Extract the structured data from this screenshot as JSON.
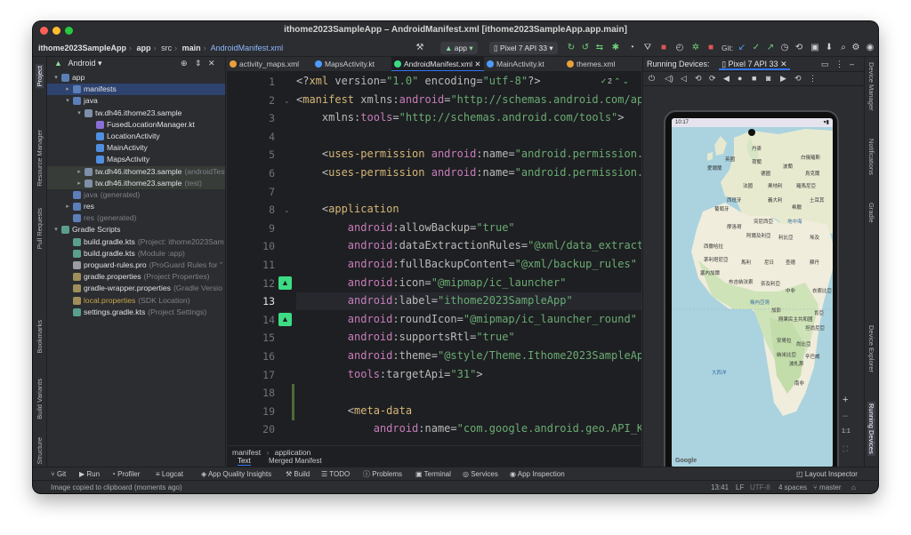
{
  "window": {
    "title": "ithome2023SampleApp – AndroidManifest.xml [ithome2023SampleApp.app.main]"
  },
  "toolbar": {
    "breadcrumb": [
      "ithome2023SampleApp",
      "app",
      "src",
      "main",
      "AndroidManifest.xml"
    ],
    "run_config": "app",
    "device": "Pixel 7 API 33",
    "git_label": "Git:"
  },
  "left_strip": [
    "Project",
    "Resource Manager",
    "Pull Requests",
    "Bookmarks",
    "Build Variants",
    "Structure"
  ],
  "right_strip": [
    "Device Manager",
    "Notifications",
    "Gradle",
    "Device Explorer",
    "Running Devices"
  ],
  "project": {
    "view": "Android",
    "tree": [
      {
        "label": "app",
        "extra": "",
        "depth": 0,
        "arrow": "▾",
        "icon": "folder-icon",
        "state": "normal"
      },
      {
        "label": "manifests",
        "extra": "",
        "depth": 1,
        "arrow": "▸",
        "icon": "folder-icon",
        "state": "selected"
      },
      {
        "label": "java",
        "extra": "",
        "depth": 1,
        "arrow": "▾",
        "icon": "folder-icon",
        "state": "normal"
      },
      {
        "label": "tw.dh46.ithome23.sample",
        "extra": "",
        "depth": 2,
        "arrow": "▾",
        "icon": "package-icon",
        "state": "normal"
      },
      {
        "label": "FusedLocationManager.kt",
        "extra": "",
        "depth": 3,
        "arrow": "",
        "icon": "kotlin-file-icon",
        "state": "normal"
      },
      {
        "label": "LocationActivity",
        "extra": "",
        "depth": 3,
        "arrow": "",
        "icon": "kotlin-class-icon",
        "state": "normal"
      },
      {
        "label": "MainActivity",
        "extra": "",
        "depth": 3,
        "arrow": "",
        "icon": "kotlin-class-icon",
        "state": "normal"
      },
      {
        "label": "MapsActivity",
        "extra": "",
        "depth": 3,
        "arrow": "",
        "icon": "kotlin-class-icon",
        "state": "normal"
      },
      {
        "label": "tw.dh46.ithome23.sample",
        "extra": "(androidTest)",
        "depth": 2,
        "arrow": "▸",
        "icon": "package-icon",
        "state": "group"
      },
      {
        "label": "tw.dh46.ithome23.sample",
        "extra": "(test)",
        "depth": 2,
        "arrow": "▸",
        "icon": "package-icon",
        "state": "group"
      },
      {
        "label": "java",
        "extra": "(generated)",
        "depth": 1,
        "arrow": "",
        "icon": "folder-icon",
        "state": "normal"
      },
      {
        "label": "res",
        "extra": "",
        "depth": 1,
        "arrow": "▸",
        "icon": "folder-icon",
        "state": "normal"
      },
      {
        "label": "res",
        "extra": "(generated)",
        "depth": 1,
        "arrow": "",
        "icon": "folder-icon",
        "state": "normal"
      },
      {
        "label": "Gradle Scripts",
        "extra": "",
        "depth": 0,
        "arrow": "▾",
        "icon": "gradle-icon",
        "state": "normal"
      },
      {
        "label": "build.gradle.kts",
        "extra": "(Project: ithome2023Sam",
        "depth": 1,
        "arrow": "",
        "icon": "gradle-file-icon",
        "state": "normal"
      },
      {
        "label": "build.gradle.kts",
        "extra": "(Module :app)",
        "depth": 1,
        "arrow": "",
        "icon": "gradle-file-icon",
        "state": "normal"
      },
      {
        "label": "proguard-rules.pro",
        "extra": "(ProGuard Rules for \"",
        "depth": 1,
        "arrow": "",
        "icon": "file-icon",
        "state": "normal"
      },
      {
        "label": "gradle.properties",
        "extra": "(Project Properties)",
        "depth": 1,
        "arrow": "",
        "icon": "properties-icon",
        "state": "normal"
      },
      {
        "label": "gradle-wrapper.properties",
        "extra": "(Gradle Versio",
        "depth": 1,
        "arrow": "",
        "icon": "properties-icon",
        "state": "normal"
      },
      {
        "label": "local.properties",
        "extra": "(SDK Location)",
        "depth": 1,
        "arrow": "",
        "icon": "properties-icon",
        "state": "muted"
      },
      {
        "label": "settings.gradle.kts",
        "extra": "(Project Settings)",
        "depth": 1,
        "arrow": "",
        "icon": "gradle-file-icon",
        "state": "normal"
      }
    ]
  },
  "editor": {
    "tabs": [
      {
        "label": "activity_maps.xml",
        "active": false
      },
      {
        "label": "MapsActivity.kt",
        "active": false
      },
      {
        "label": "AndroidManifest.xml",
        "active": true
      },
      {
        "label": "MainActivity.kt",
        "active": false
      },
      {
        "label": "themes.xml",
        "active": false
      }
    ],
    "inspection_count": "2",
    "line_numbers": [
      "1",
      "2",
      "3",
      "4",
      "5",
      "6",
      "7",
      "8",
      "9",
      "10",
      "11",
      "12",
      "13",
      "14",
      "15",
      "16",
      "17",
      "18",
      "19",
      "20"
    ],
    "current_line": "13",
    "code_lines": [
      [
        [
          "p",
          "<?"
        ],
        [
          "k",
          "xml "
        ],
        [
          "a",
          "version"
        ],
        [
          "p",
          "="
        ],
        [
          "s",
          "\"1.0\" "
        ],
        [
          "a",
          "encoding"
        ],
        [
          "p",
          "="
        ],
        [
          "s",
          "\"utf-8\""
        ],
        [
          "p",
          "?>"
        ]
      ],
      [
        [
          "p",
          "<"
        ],
        [
          "k",
          "manifest "
        ],
        [
          "a",
          "xmlns:"
        ],
        [
          "ns",
          "android"
        ],
        [
          "p",
          "="
        ],
        [
          "s",
          "\"http://schemas.android.com/apk/res/android\""
        ]
      ],
      [
        [
          "p",
          "    "
        ],
        [
          "a",
          "xmlns:"
        ],
        [
          "ns",
          "tools"
        ],
        [
          "p",
          "="
        ],
        [
          "s",
          "\"http://schemas.android.com/tools\""
        ],
        [
          "p",
          ">"
        ]
      ],
      [],
      [
        [
          "p",
          "    <"
        ],
        [
          "k",
          "uses-permission "
        ],
        [
          "ns",
          "android"
        ],
        [
          "a",
          ":name"
        ],
        [
          "p",
          "="
        ],
        [
          "s",
          "\"android.permission.ACCESS_FINE_LOCATION\""
        ]
      ],
      [
        [
          "p",
          "    <"
        ],
        [
          "k",
          "uses-permission "
        ],
        [
          "ns",
          "android"
        ],
        [
          "a",
          ":name"
        ],
        [
          "p",
          "="
        ],
        [
          "s",
          "\"android.permission.ACCESS_COARSE_LOCATION\""
        ]
      ],
      [],
      [
        [
          "p",
          "    <"
        ],
        [
          "k",
          "application"
        ]
      ],
      [
        [
          "p",
          "        "
        ],
        [
          "ns",
          "android"
        ],
        [
          "a",
          ":allowBackup"
        ],
        [
          "p",
          "="
        ],
        [
          "s",
          "\"true\""
        ]
      ],
      [
        [
          "p",
          "        "
        ],
        [
          "ns",
          "android"
        ],
        [
          "a",
          ":dataExtractionRules"
        ],
        [
          "p",
          "="
        ],
        [
          "s",
          "\"@xml/data_extraction_rules\""
        ]
      ],
      [
        [
          "p",
          "        "
        ],
        [
          "ns",
          "android"
        ],
        [
          "a",
          ":fullBackupContent"
        ],
        [
          "p",
          "="
        ],
        [
          "s",
          "\"@xml/backup_rules\""
        ]
      ],
      [
        [
          "p",
          "        "
        ],
        [
          "ns",
          "android"
        ],
        [
          "a",
          ":icon"
        ],
        [
          "p",
          "="
        ],
        [
          "s",
          "\"@mipmap/ic_launcher\""
        ]
      ],
      [
        [
          "p",
          "        "
        ],
        [
          "ns",
          "android"
        ],
        [
          "a",
          ":label"
        ],
        [
          "p",
          "="
        ],
        [
          "s",
          "\"ithome2023SampleApp\""
        ]
      ],
      [
        [
          "p",
          "        "
        ],
        [
          "ns",
          "android"
        ],
        [
          "a",
          ":roundIcon"
        ],
        [
          "p",
          "="
        ],
        [
          "s",
          "\"@mipmap/ic_launcher_round\""
        ]
      ],
      [
        [
          "p",
          "        "
        ],
        [
          "ns",
          "android"
        ],
        [
          "a",
          ":supportsRtl"
        ],
        [
          "p",
          "="
        ],
        [
          "s",
          "\"true\""
        ]
      ],
      [
        [
          "p",
          "        "
        ],
        [
          "ns",
          "android"
        ],
        [
          "a",
          ":theme"
        ],
        [
          "p",
          "="
        ],
        [
          "s",
          "\"@style/Theme.Ithome2023SampleApp\""
        ]
      ],
      [
        [
          "p",
          "        "
        ],
        [
          "ns",
          "tools"
        ],
        [
          "a",
          ":targetApi"
        ],
        [
          "p",
          "="
        ],
        [
          "s",
          "\"31\""
        ],
        [
          "p",
          ">"
        ]
      ],
      [],
      [
        [
          "p",
          "        <"
        ],
        [
          "k",
          "meta-data"
        ]
      ],
      [
        [
          "p",
          "            "
        ],
        [
          "ns",
          "android"
        ],
        [
          "a",
          ":name"
        ],
        [
          "p",
          "="
        ],
        [
          "s",
          "\"com.google.android.geo.API_KEY\""
        ]
      ]
    ],
    "breadcrumb": [
      "manifest",
      "application"
    ],
    "bottom_tabs": [
      "Text",
      "Merged Manifest"
    ]
  },
  "device_panel": {
    "header": "Running Devices:",
    "device_tab": "Pixel 7 API 33",
    "phone_time": "10:17",
    "map_labels": [
      "丹麥",
      "英國",
      "荷蘭",
      "白俄羅斯",
      "愛爾蘭",
      "德國",
      "波蘭",
      "烏克蘭",
      "法國",
      "奧地利",
      "羅馬尼亞",
      "西班牙",
      "義大利",
      "土耳其",
      "葡萄牙",
      "希臘",
      "突尼西亞",
      "摩洛哥",
      "阿爾及利亞",
      "利比亞",
      "埃及",
      "西撒哈拉",
      "茅利塔尼亞",
      "馬利",
      "尼日",
      "查德",
      "蘇丹",
      "塞內加爾",
      "布吉納法索",
      "奈及利亞",
      "中非",
      "衣索比亞",
      "幾內亞灣",
      "加彭",
      "剛果民主共和國",
      "肯亞",
      "坦尚尼亞",
      "安哥拉",
      "尚比亞",
      "納米比亞",
      "辛巴威",
      "波札那",
      "南非",
      "大西洋",
      "地中海",
      "Google"
    ]
  },
  "bottom_tools": [
    "Git",
    "Run",
    "Profiler",
    "Logcat",
    "App Quality Insights",
    "Build",
    "TODO",
    "Problems",
    "Terminal",
    "Services",
    "App Inspection",
    "Layout Inspector"
  ],
  "status": {
    "message": "Image copied to clipboard (moments ago)",
    "position": "13:41",
    "line_sep": "LF",
    "encoding": "UTF-8",
    "indent": "4 spaces",
    "branch": "master"
  },
  "colors": {
    "accent": "#3574f0",
    "traffic_red": "#ff5f57",
    "traffic_yellow": "#febc2e",
    "traffic_green": "#28c840",
    "android_green": "#3ddc84"
  }
}
